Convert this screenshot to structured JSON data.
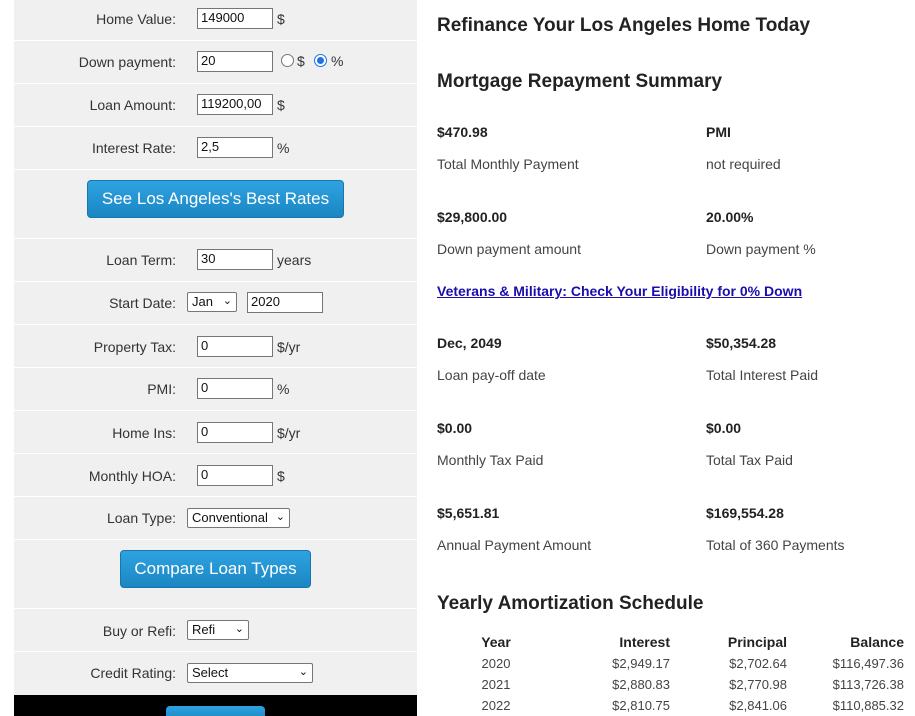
{
  "form": {
    "home_value": {
      "label": "Home Value:",
      "value": "149000",
      "unit": "$"
    },
    "down_payment": {
      "label": "Down payment:",
      "value": "20",
      "radio_dollar": "$",
      "radio_percent": "%",
      "selected": "%"
    },
    "loan_amount": {
      "label": "Loan Amount:",
      "value": "119200,00",
      "unit": "$"
    },
    "interest_rate": {
      "label": "Interest Rate:",
      "value": "2,5",
      "unit": "%"
    },
    "best_rates_button": "See Los Angeles's Best Rates",
    "loan_term": {
      "label": "Loan Term:",
      "value": "30",
      "unit": "years"
    },
    "start_date": {
      "label": "Start Date:",
      "month": "Jan",
      "year": "2020"
    },
    "property_tax": {
      "label": "Property Tax:",
      "value": "0",
      "unit": "$/yr"
    },
    "pmi": {
      "label": "PMI:",
      "value": "0",
      "unit": "%"
    },
    "home_ins": {
      "label": "Home Ins:",
      "value": "0",
      "unit": "$/yr"
    },
    "monthly_hoa": {
      "label": "Monthly HOA:",
      "value": "0",
      "unit": "$"
    },
    "loan_type": {
      "label": "Loan Type:",
      "value": "Conventional"
    },
    "compare_button": "Compare Loan Types",
    "buy_or_refi": {
      "label": "Buy or Refi:",
      "value": "Refi"
    },
    "credit_rating": {
      "label": "Credit Rating:",
      "value": "Select"
    }
  },
  "summary": {
    "headline": "Refinance Your Los Angeles Home Today",
    "title": "Mortgage Repayment Summary",
    "items": [
      {
        "value": "$470.98",
        "label": "Total Monthly Payment"
      },
      {
        "value": "PMI",
        "label": "not required"
      },
      {
        "value": "$29,800.00",
        "label": "Down payment amount"
      },
      {
        "value": "20.00%",
        "label": "Down payment %"
      },
      {
        "value": "Dec, 2049",
        "label": "Loan pay-off date"
      },
      {
        "value": "$50,354.28",
        "label": "Total Interest Paid"
      },
      {
        "value": "$0.00",
        "label": "Monthly Tax Paid"
      },
      {
        "value": "$0.00",
        "label": "Total Tax Paid"
      },
      {
        "value": "$5,651.81",
        "label": "Annual Payment Amount"
      },
      {
        "value": "$169,554.28",
        "label": "Total of 360 Payments"
      }
    ],
    "veterans_link": "Veterans & Military: Check Your Eligibility for 0% Down"
  },
  "amortization": {
    "title": "Yearly Amortization Schedule",
    "headers": [
      "Year",
      "Interest",
      "Principal",
      "Balance"
    ],
    "rows": [
      [
        "2020",
        "$2,949.17",
        "$2,702.64",
        "$116,497.36"
      ],
      [
        "2021",
        "$2,880.83",
        "$2,770.98",
        "$113,726.38"
      ],
      [
        "2022",
        "$2,810.75",
        "$2,841.06",
        "$110,885.32"
      ]
    ]
  },
  "colors": {
    "button_blue": "#1b86c4",
    "link": "#1a0dab",
    "panel": "#f0f0f0"
  }
}
